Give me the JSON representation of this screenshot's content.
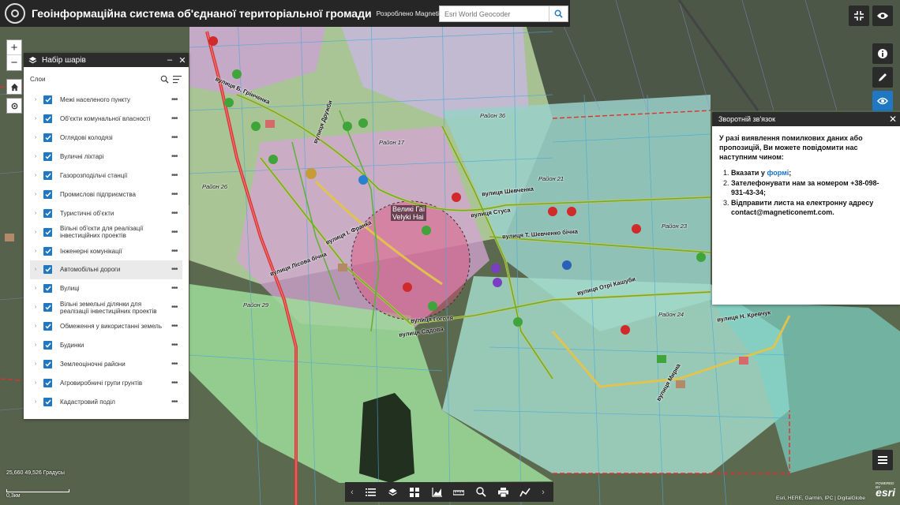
{
  "app": {
    "title": "Геоінформаційна система об'єднаної територіальної громади",
    "subtitle": "Розроблено MagneticOne Municipal Technologies"
  },
  "search": {
    "placeholder": "Esri World Geocoder"
  },
  "layers_panel": {
    "title": "Набір шарів",
    "toolbar_label": "Слои",
    "items": [
      {
        "label": "Межі населеного пункту"
      },
      {
        "label": "Об'єкти комунальної власності"
      },
      {
        "label": "Оглядові колодязі"
      },
      {
        "label": "Вуличні ліхтарі"
      },
      {
        "label": "Газорозподільчі станції"
      },
      {
        "label": "Промислові підприємства"
      },
      {
        "label": "Туристичні об'єкти"
      },
      {
        "label": "Вільні об'єкти для реалізації інвестиційних проектів"
      },
      {
        "label": "Інженерні комунікації"
      },
      {
        "label": "Автомобільні дороги"
      },
      {
        "label": "Вулиці"
      },
      {
        "label": "Вільні земельні ділянки для реалізації інвестиційних проектів"
      },
      {
        "label": "Обмеження у використанні земель"
      },
      {
        "label": "Будинки"
      },
      {
        "label": "Землеоціночні райони"
      },
      {
        "label": "Агровиробничі групи грунтів"
      },
      {
        "label": "Кадастровий поділ"
      }
    ]
  },
  "feedback": {
    "title": "Зворотній зв'язок",
    "intro": "У разі виявлення помилкових даних або пропозицій, Ви можете повідомити нас наступним чином:",
    "item1_prefix": "Вказати у ",
    "item1_link": "формі",
    "item1_suffix": ";",
    "item2": "Зателефонувати нам за номером +38-098-931-43-34;",
    "item3": "Відправити листа на електронну адресу contact@magneticonemt.com."
  },
  "map": {
    "coordinates": "25,660 49,526 Градусы",
    "scale_label": "0,3км",
    "attribution": "Esri, HERE, Garmin, IPC | DigitalGlobe",
    "brand": "esri",
    "brand_small": "POWERED BY",
    "center_label_1": "Великі Гаї",
    "center_label_2": "Velyki Hai",
    "street_labels": [
      "вулиця Стуса",
      "вулиця Б. Грінченка",
      "вулиця Шевченка",
      "вулиця Т. Шевченко бічна",
      "вулиця Отрі Кашуби",
      "вулиця Гоголя",
      "вулиця Садова",
      "вулиця Лісова бічна",
      "вулиця І. Франка",
      "вулиця Дружби",
      "вулиця Мирна",
      "вулиця Н. Кревчук"
    ],
    "district_labels": [
      "Район 17",
      "Район 21",
      "Район 23",
      "Район 24",
      "Район 26",
      "Район 29",
      "Район 36"
    ]
  },
  "colors": {
    "accent": "#1f78c1",
    "header_bg": "#262626"
  }
}
